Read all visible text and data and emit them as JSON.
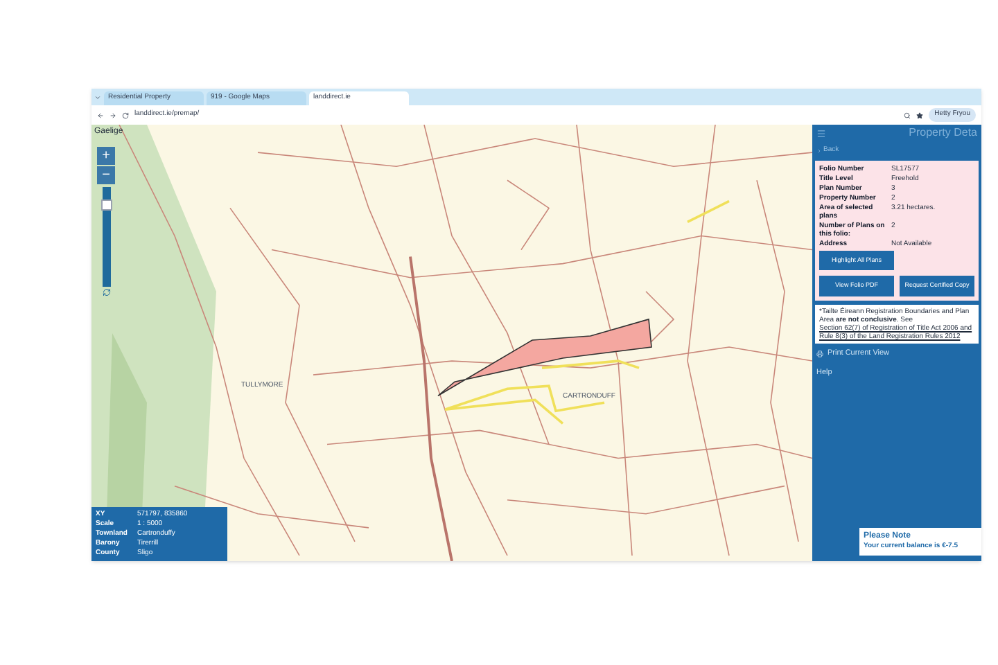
{
  "browser": {
    "tabs": [
      {
        "label": "Residential Property",
        "selected": false
      },
      {
        "label": "919 - Google Maps",
        "selected": false
      },
      {
        "label": "landdirect.ie",
        "selected": true
      }
    ],
    "address": "landdirect.ie/premap/",
    "profile": "Hetty Fryou"
  },
  "map": {
    "language_link": "Gaelige",
    "zoom_in": "+",
    "zoom_out": "−",
    "zoom_slider": {
      "level": 0.88
    },
    "labels": [
      {
        "text": "TULLYMORE"
      },
      {
        "text": "CARTRONDUFF"
      }
    ],
    "info": [
      {
        "label": "XY",
        "value": "571797, 835860"
      },
      {
        "label": "Scale",
        "value": "1 : 5000"
      },
      {
        "label": "Townland",
        "value": "Cartronduffy"
      },
      {
        "label": "Barony",
        "value": "Tirerrill"
      },
      {
        "label": "County",
        "value": "Sligo"
      }
    ]
  },
  "panel": {
    "title": "Property Deta",
    "back": "Back",
    "details": [
      {
        "label": "Folio Number",
        "value": "SL17577"
      },
      {
        "label": "Title Level",
        "value": "Freehold"
      },
      {
        "label": "Plan Number",
        "value": "3"
      },
      {
        "label": "Property Number",
        "value": "2"
      },
      {
        "label": "Area of selected plans",
        "value": "3.21 hectares."
      },
      {
        "label": "Number of Plans on this folio:",
        "value": "2"
      },
      {
        "label": "Address",
        "value": "Not Available"
      }
    ],
    "buttons": [
      "Highlight All Plans",
      "View Folio PDF",
      "Request Certified Copy"
    ],
    "notice": "*Tailte Éireann Registration Boundaries and Plan Area **are not conclusive**. See",
    "notice_link": "Section 62(7) of Registration of Title Act 2006 and Rule 8(3) of the Land Registration Rules 2012",
    "menu": [
      {
        "kind": "print",
        "label": "Print Current View"
      },
      {
        "kind": "plain",
        "label": "Help"
      }
    ],
    "note_title": "Please Note",
    "note_text": "Your current balance is €-7.5"
  }
}
